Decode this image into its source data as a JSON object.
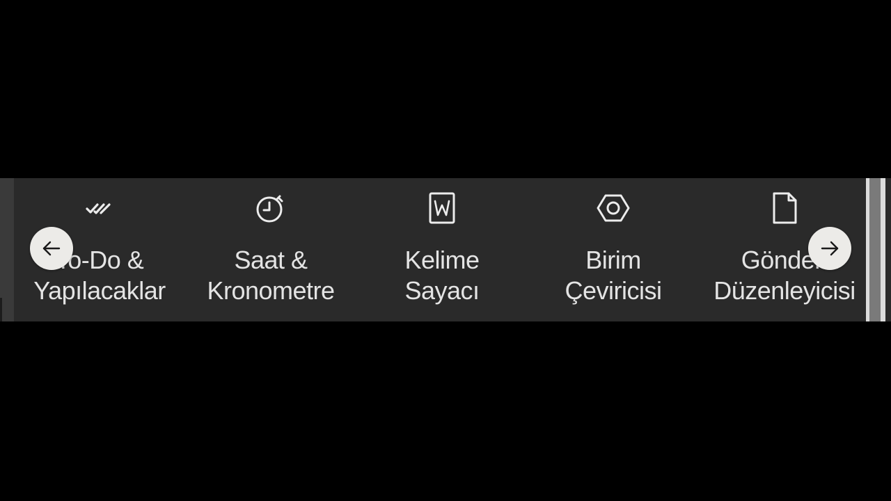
{
  "tools": [
    {
      "line1": "To-Do &",
      "line2": "Yapılacaklar",
      "icon": "double-check-icon"
    },
    {
      "line1": "Saat &",
      "line2": "Kronometre",
      "icon": "stopwatch-icon"
    },
    {
      "line1": "Kelime",
      "line2": "Sayacı",
      "icon": "word-document-icon"
    },
    {
      "line1": "Birim",
      "line2": "Çeviricisi",
      "icon": "hexagon-nut-icon"
    },
    {
      "line1": "Gönderi",
      "line2": "Düzenleyicisi",
      "icon": "document-icon"
    }
  ],
  "nav": {
    "prev_icon": "arrow-left-icon",
    "next_icon": "arrow-right-icon"
  },
  "colors": {
    "strip_background": "#2a2a2a",
    "text": "#e4e4e4",
    "nav_button": "#ecebe8"
  }
}
